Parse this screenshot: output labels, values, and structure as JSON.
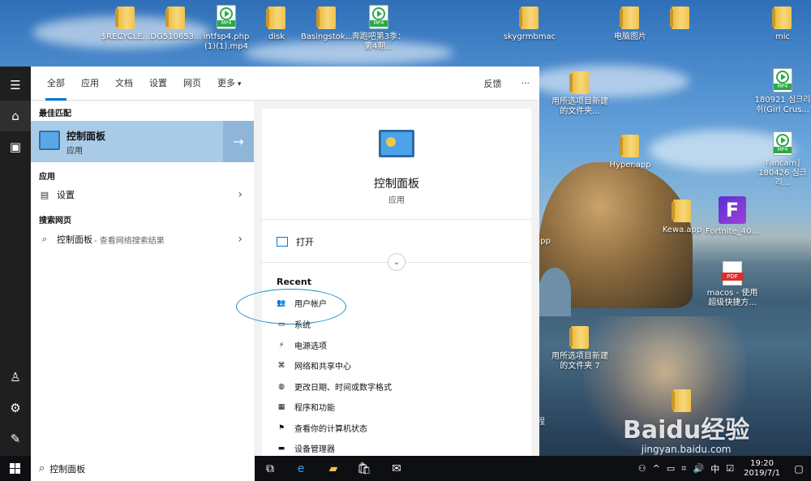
{
  "desktop": {
    "icons": [
      {
        "type": "folder",
        "label": "$RECYCLE..."
      },
      {
        "type": "folder",
        "label": "DG510653..."
      },
      {
        "type": "mp4",
        "label": "intfsp4.php (1)(1).mp4"
      },
      {
        "type": "folder",
        "label": "disk"
      },
      {
        "type": "folder",
        "label": "Basingstok..."
      },
      {
        "type": "mp4",
        "label": "奔跑吧第3季：第4期..."
      },
      {
        "type": "folder",
        "label": "skygrmbmac"
      },
      {
        "type": "folder",
        "label": "电脑图片"
      },
      {
        "type": "folder",
        "label": ""
      },
      {
        "type": "folder",
        "label": "mic"
      },
      {
        "type": "folder",
        "label": "用所选项目新建的文件夹..."
      },
      {
        "type": "mp4",
        "label": "180921 심크리쉬(Girl Crus..."
      },
      {
        "type": "folder",
        "label": "Hyper.app"
      },
      {
        "type": "mp4",
        "label": "Fancam] 180426 심크리..."
      },
      {
        "type": "folder",
        "label": "Kewa.app"
      },
      {
        "type": "fortnite",
        "label": "Fortnite_40..."
      },
      {
        "type": "pdf",
        "label": "macos - 使用超级快捷方..."
      },
      {
        "type": "folder",
        "label": "用所选项目新建的文件夹 7"
      },
      {
        "type": "folder",
        "label": ""
      }
    ],
    "partial_labels": {
      "app": "app",
      "cheng": "程"
    },
    "mp4_tag": "MP4",
    "pdf_tag": "PDF",
    "fortnite_glyph": "F"
  },
  "rail": {
    "icons": [
      "hamburger-icon",
      "home-icon",
      "document-icon",
      "user-icon",
      "settings-icon",
      "feedback-icon"
    ]
  },
  "tabs": {
    "items": [
      "全部",
      "应用",
      "文档",
      "设置",
      "网页",
      "更多"
    ],
    "feedback": "反馈",
    "more_options": "···"
  },
  "results": {
    "best_match_header": "最佳匹配",
    "best_match": {
      "title": "控制面板",
      "subtitle": "应用",
      "arrow": "→"
    },
    "apps_header": "应用",
    "apps": [
      {
        "label": "设置"
      }
    ],
    "web_header": "搜索网页",
    "web": {
      "label": "控制面板",
      "sub": "- 查看网络搜索结果"
    }
  },
  "detail": {
    "title": "控制面板",
    "subtitle": "应用",
    "open_label": "打开",
    "recent_header": "Recent",
    "recent": [
      "用户帐户",
      "系统",
      "电源选项",
      "网络和共享中心",
      "更改日期、时间或数字格式",
      "程序和功能",
      "查看你的计算机状态",
      "设备管理器"
    ]
  },
  "taskbar": {
    "search_value": "控制面板",
    "clock_time": "19:20",
    "clock_date": "2019/7/1",
    "ime": "中"
  },
  "watermark": {
    "text": "Baidu经验",
    "url": "jingyan.baidu.com"
  },
  "colors": {
    "accent": "#0078d7",
    "selection": "#aacbe8",
    "highlight_ellipse": "#1e8fc8"
  }
}
